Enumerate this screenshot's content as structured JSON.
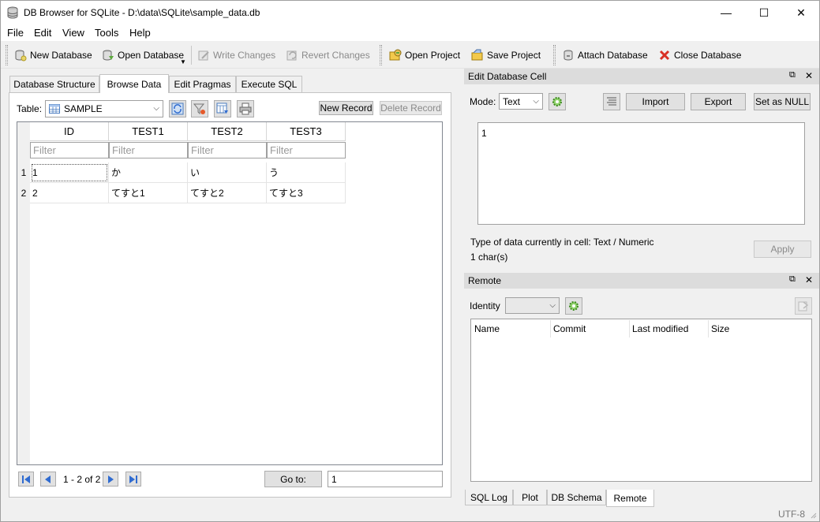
{
  "window": {
    "title": "DB Browser for SQLite - D:\\data\\SQLite\\sample_data.db",
    "minimize": "—",
    "maximize": "☐",
    "close": "✕"
  },
  "menu": [
    "File",
    "Edit",
    "View",
    "Tools",
    "Help"
  ],
  "toolbar": {
    "new_database": "New Database",
    "open_database": "Open Database",
    "write_changes": "Write Changes",
    "revert_changes": "Revert Changes",
    "open_project": "Open Project",
    "save_project": "Save Project",
    "attach_database": "Attach Database",
    "close_database": "Close Database"
  },
  "tabs": [
    "Database Structure",
    "Browse Data",
    "Edit Pragmas",
    "Execute SQL"
  ],
  "active_tab": "Browse Data",
  "browse": {
    "table_label": "Table:",
    "table_value": "SAMPLE",
    "new_record": "New Record",
    "delete_record": "Delete Record",
    "columns": [
      "ID",
      "TEST1",
      "TEST2",
      "TEST3"
    ],
    "filter_placeholder": "Filter",
    "rows": [
      {
        "num": "1",
        "cells": [
          "1",
          "か",
          "い",
          "う"
        ]
      },
      {
        "num": "2",
        "cells": [
          "2",
          "てすと1",
          "てすと2",
          "てすと3"
        ]
      }
    ],
    "pagination": "1 - 2 of 2",
    "goto_label": "Go to:",
    "goto_value": "1"
  },
  "edit_cell": {
    "title": "Edit Database Cell",
    "mode_label": "Mode:",
    "mode_value": "Text",
    "import": "Import",
    "export": "Export",
    "set_null": "Set as NULL",
    "content": "1",
    "type_info": "Type of data currently in cell: Text / Numeric",
    "char_count": "1 char(s)",
    "apply": "Apply"
  },
  "remote": {
    "title": "Remote",
    "identity_label": "Identity",
    "columns": [
      "Name",
      "Commit",
      "Last modified",
      "Size"
    ]
  },
  "bottom_tabs": [
    "SQL Log",
    "Plot",
    "DB Schema",
    "Remote"
  ],
  "active_bottom_tab": "Remote",
  "status": {
    "encoding": "UTF-8"
  }
}
